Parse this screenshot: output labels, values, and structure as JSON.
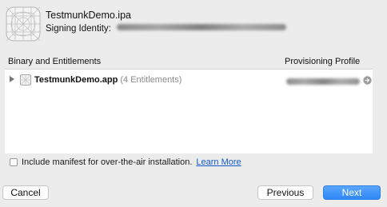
{
  "header": {
    "title": "TestmunkDemo.ipa",
    "signing_label": "Signing Identity:",
    "app_icon": "app-placeholder-icon"
  },
  "columns": {
    "binary": "Binary and Entitlements",
    "profile": "Provisioning Profile"
  },
  "rows": [
    {
      "name": "TestmunkDemo.app",
      "entitlements": "(4 Entitlements)",
      "icon": "app-bundle-icon",
      "profile_action_icon": "arrow-right-circle-icon"
    }
  ],
  "manifest": {
    "label": "Include manifest for over-the-air installation.",
    "link": "Learn More",
    "checked": false
  },
  "buttons": {
    "cancel": "Cancel",
    "previous": "Previous",
    "next": "Next"
  },
  "colors": {
    "accent": "#2e86f7",
    "link": "#1259c9",
    "background": "#ececec"
  }
}
